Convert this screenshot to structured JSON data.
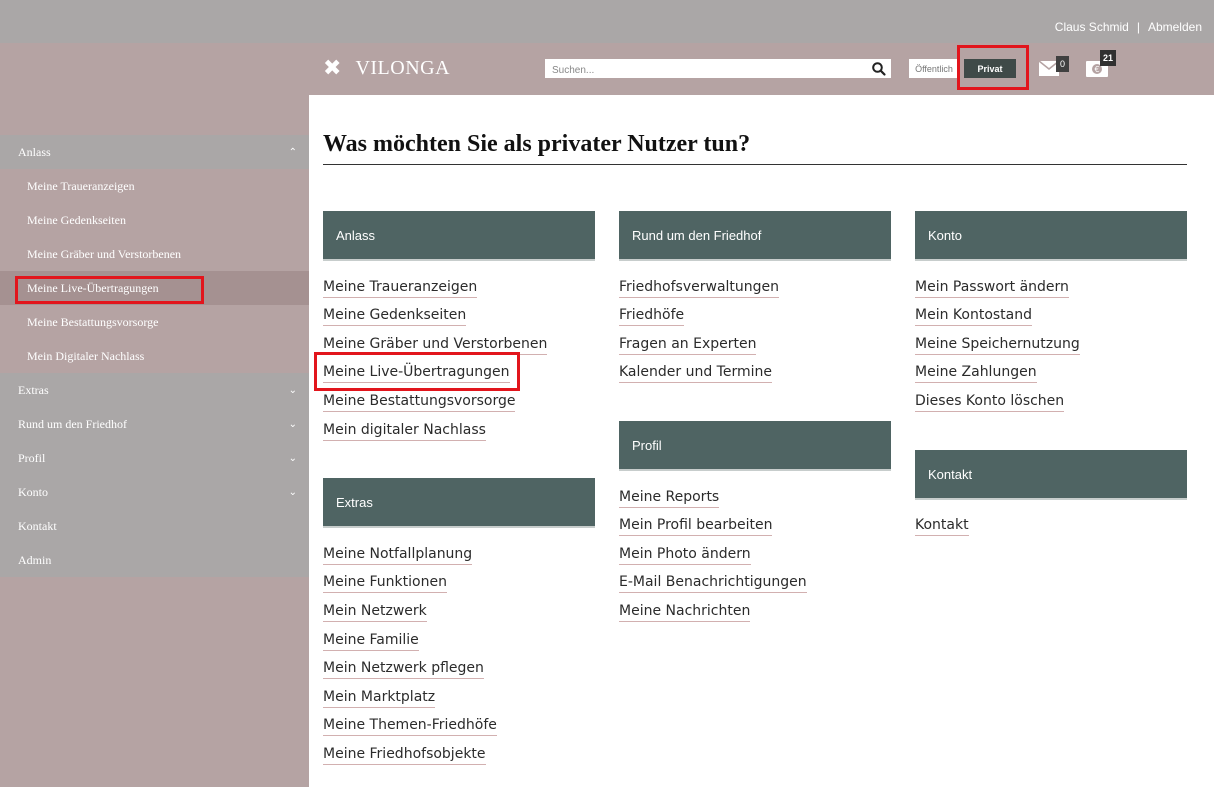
{
  "topbar": {
    "user_name": "Claus Schmid",
    "separator": "|",
    "logout": "Abmelden"
  },
  "header": {
    "logo_mark": "✖",
    "logo_text": "VILONGA",
    "search_placeholder": "Suchen...",
    "toggle_public": "Öffentlich",
    "toggle_private": "Privat",
    "mail_count": "0",
    "money_count": "21"
  },
  "sidebar": {
    "sections": [
      {
        "label": "Anlass",
        "chevron": "⌃"
      },
      {
        "label": "Extras",
        "chevron": "⌄"
      },
      {
        "label": "Rund um den Friedhof",
        "chevron": "⌄"
      },
      {
        "label": "Profil",
        "chevron": "⌄"
      },
      {
        "label": "Konto",
        "chevron": "⌄"
      },
      {
        "label": "Kontakt"
      },
      {
        "label": "Admin"
      }
    ],
    "anlass_items": [
      "Meine Traueranzeigen",
      "Meine Gedenkseiten",
      "Meine Gräber und Verstorbenen",
      "Meine Live-Übertragungen",
      "Meine Bestattungsvorsorge",
      "Mein Digitaler Nachlass"
    ]
  },
  "main": {
    "title": "Was möchten Sie als privater Nutzer tun?",
    "categories": {
      "anlass": {
        "title": "Anlass",
        "links": [
          "Meine Traueranzeigen",
          "Meine Gedenkseiten",
          "Meine Gräber und Verstorbenen",
          "Meine Live-Übertragungen",
          "Meine Bestattungsvorsorge",
          "Mein digitaler Nachlass"
        ]
      },
      "extras": {
        "title": "Extras",
        "links": [
          "Meine Notfallplanung",
          "Meine Funktionen",
          "Mein Netzwerk",
          "Meine Familie",
          "Mein Netzwerk pflegen",
          "Mein Marktplatz",
          "Meine Themen-Friedhöfe",
          "Meine Friedhofsobjekte"
        ]
      },
      "friedhof": {
        "title": "Rund um den Friedhof",
        "links": [
          "Friedhofsverwaltungen",
          "Friedhöfe",
          "Fragen an Experten",
          "Kalender und Termine"
        ]
      },
      "profil": {
        "title": "Profil",
        "links": [
          "Meine Reports",
          "Mein Profil bearbeiten",
          "Mein Photo ändern",
          "E-Mail Benachrichtigungen",
          "Meine Nachrichten"
        ]
      },
      "konto": {
        "title": "Konto",
        "links": [
          "Mein Passwort ändern",
          "Mein Kontostand",
          "Meine Speichernutzung",
          "Meine Zahlungen",
          "Dieses Konto löschen"
        ]
      },
      "kontakt": {
        "title": "Kontakt",
        "links": [
          "Kontakt"
        ]
      }
    }
  },
  "colors": {
    "topbar": "#aaa7a7",
    "header": "#b5a3a3",
    "category_header": "#4f6463",
    "highlight": "#e2151c",
    "private_toggle": "#3f4a48"
  }
}
